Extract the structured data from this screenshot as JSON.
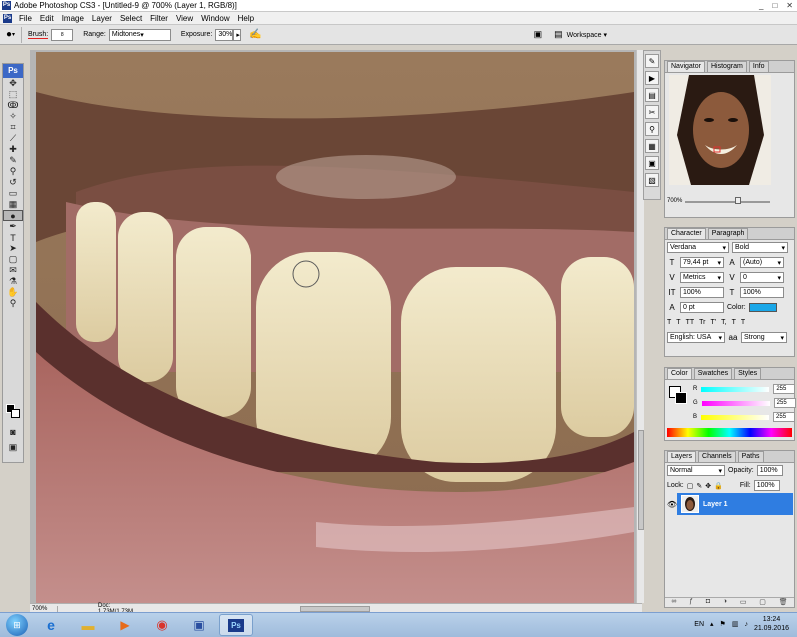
{
  "window": {
    "title": "Adobe Photoshop CS3 - [Untitled-9 @ 700% (Layer 1, RGB/8)]",
    "controls": [
      "_",
      "□",
      "✕"
    ]
  },
  "menu": [
    "File",
    "Edit",
    "Image",
    "Layer",
    "Select",
    "Filter",
    "View",
    "Window",
    "Help"
  ],
  "options": {
    "brush_label": "Brush:",
    "brush_size": "8",
    "range_label": "Range:",
    "range_value": "Midtones",
    "exposure_label": "Exposure:",
    "exposure_value": "30%",
    "workspace_label": "Workspace"
  },
  "toolbox": {
    "logo": "Ps",
    "tools": [
      "move-icon",
      "marquee-icon",
      "lasso-icon",
      "magic-wand-icon",
      "crop-icon",
      "slice-icon",
      "healing-icon",
      "brush-icon",
      "clone-stamp-icon",
      "history-brush-icon",
      "eraser-icon",
      "gradient-icon",
      "dodge-icon",
      "pen-icon",
      "type-icon",
      "path-select-icon",
      "shape-icon",
      "notes-icon",
      "eyedropper-icon",
      "hand-icon",
      "zoom-icon"
    ],
    "active_tool": "dodge-icon"
  },
  "status": {
    "zoom": "700%",
    "doc": "Doc: 1,73M/1,73M"
  },
  "navigator": {
    "tabs": [
      "Navigator",
      "Histogram",
      "Info"
    ],
    "zoom": "700%"
  },
  "character": {
    "tabs": [
      "Character",
      "Paragraph"
    ],
    "font_family": "Verdana",
    "font_style": "Bold",
    "font_size": "79,44 pt",
    "leading": "(Auto)",
    "kerning": "Metrics",
    "tracking": "0",
    "vertical_scale": "100%",
    "horizontal_scale": "100%",
    "baseline_shift": "0 pt",
    "color_label": "Color:",
    "color_hex": "#1aa7e8",
    "language": "English: USA",
    "antialias": "Strong",
    "style_buttons": [
      "T",
      "T",
      "TT",
      "Tr",
      "T'",
      "T,",
      "T",
      "T"
    ]
  },
  "color": {
    "tabs": [
      "Color",
      "Swatches",
      "Styles"
    ],
    "channels": [
      {
        "label": "R",
        "value": "255"
      },
      {
        "label": "G",
        "value": "255"
      },
      {
        "label": "B",
        "value": "255"
      }
    ]
  },
  "layers": {
    "tabs": [
      "Layers",
      "Channels",
      "Paths"
    ],
    "blend_mode": "Normal",
    "opacity_label": "Opacity:",
    "opacity": "100%",
    "lock_label": "Lock:",
    "fill_label": "Fill:",
    "fill": "100%",
    "layer_name": "Layer 1",
    "footer_icons": [
      "link-icon",
      "fx-icon",
      "mask-icon",
      "adjustment-icon",
      "folder-icon",
      "new-layer-icon",
      "trash-icon"
    ]
  },
  "taskbar": {
    "language": "EN",
    "time": "13:24",
    "date": "21.09.2016"
  }
}
